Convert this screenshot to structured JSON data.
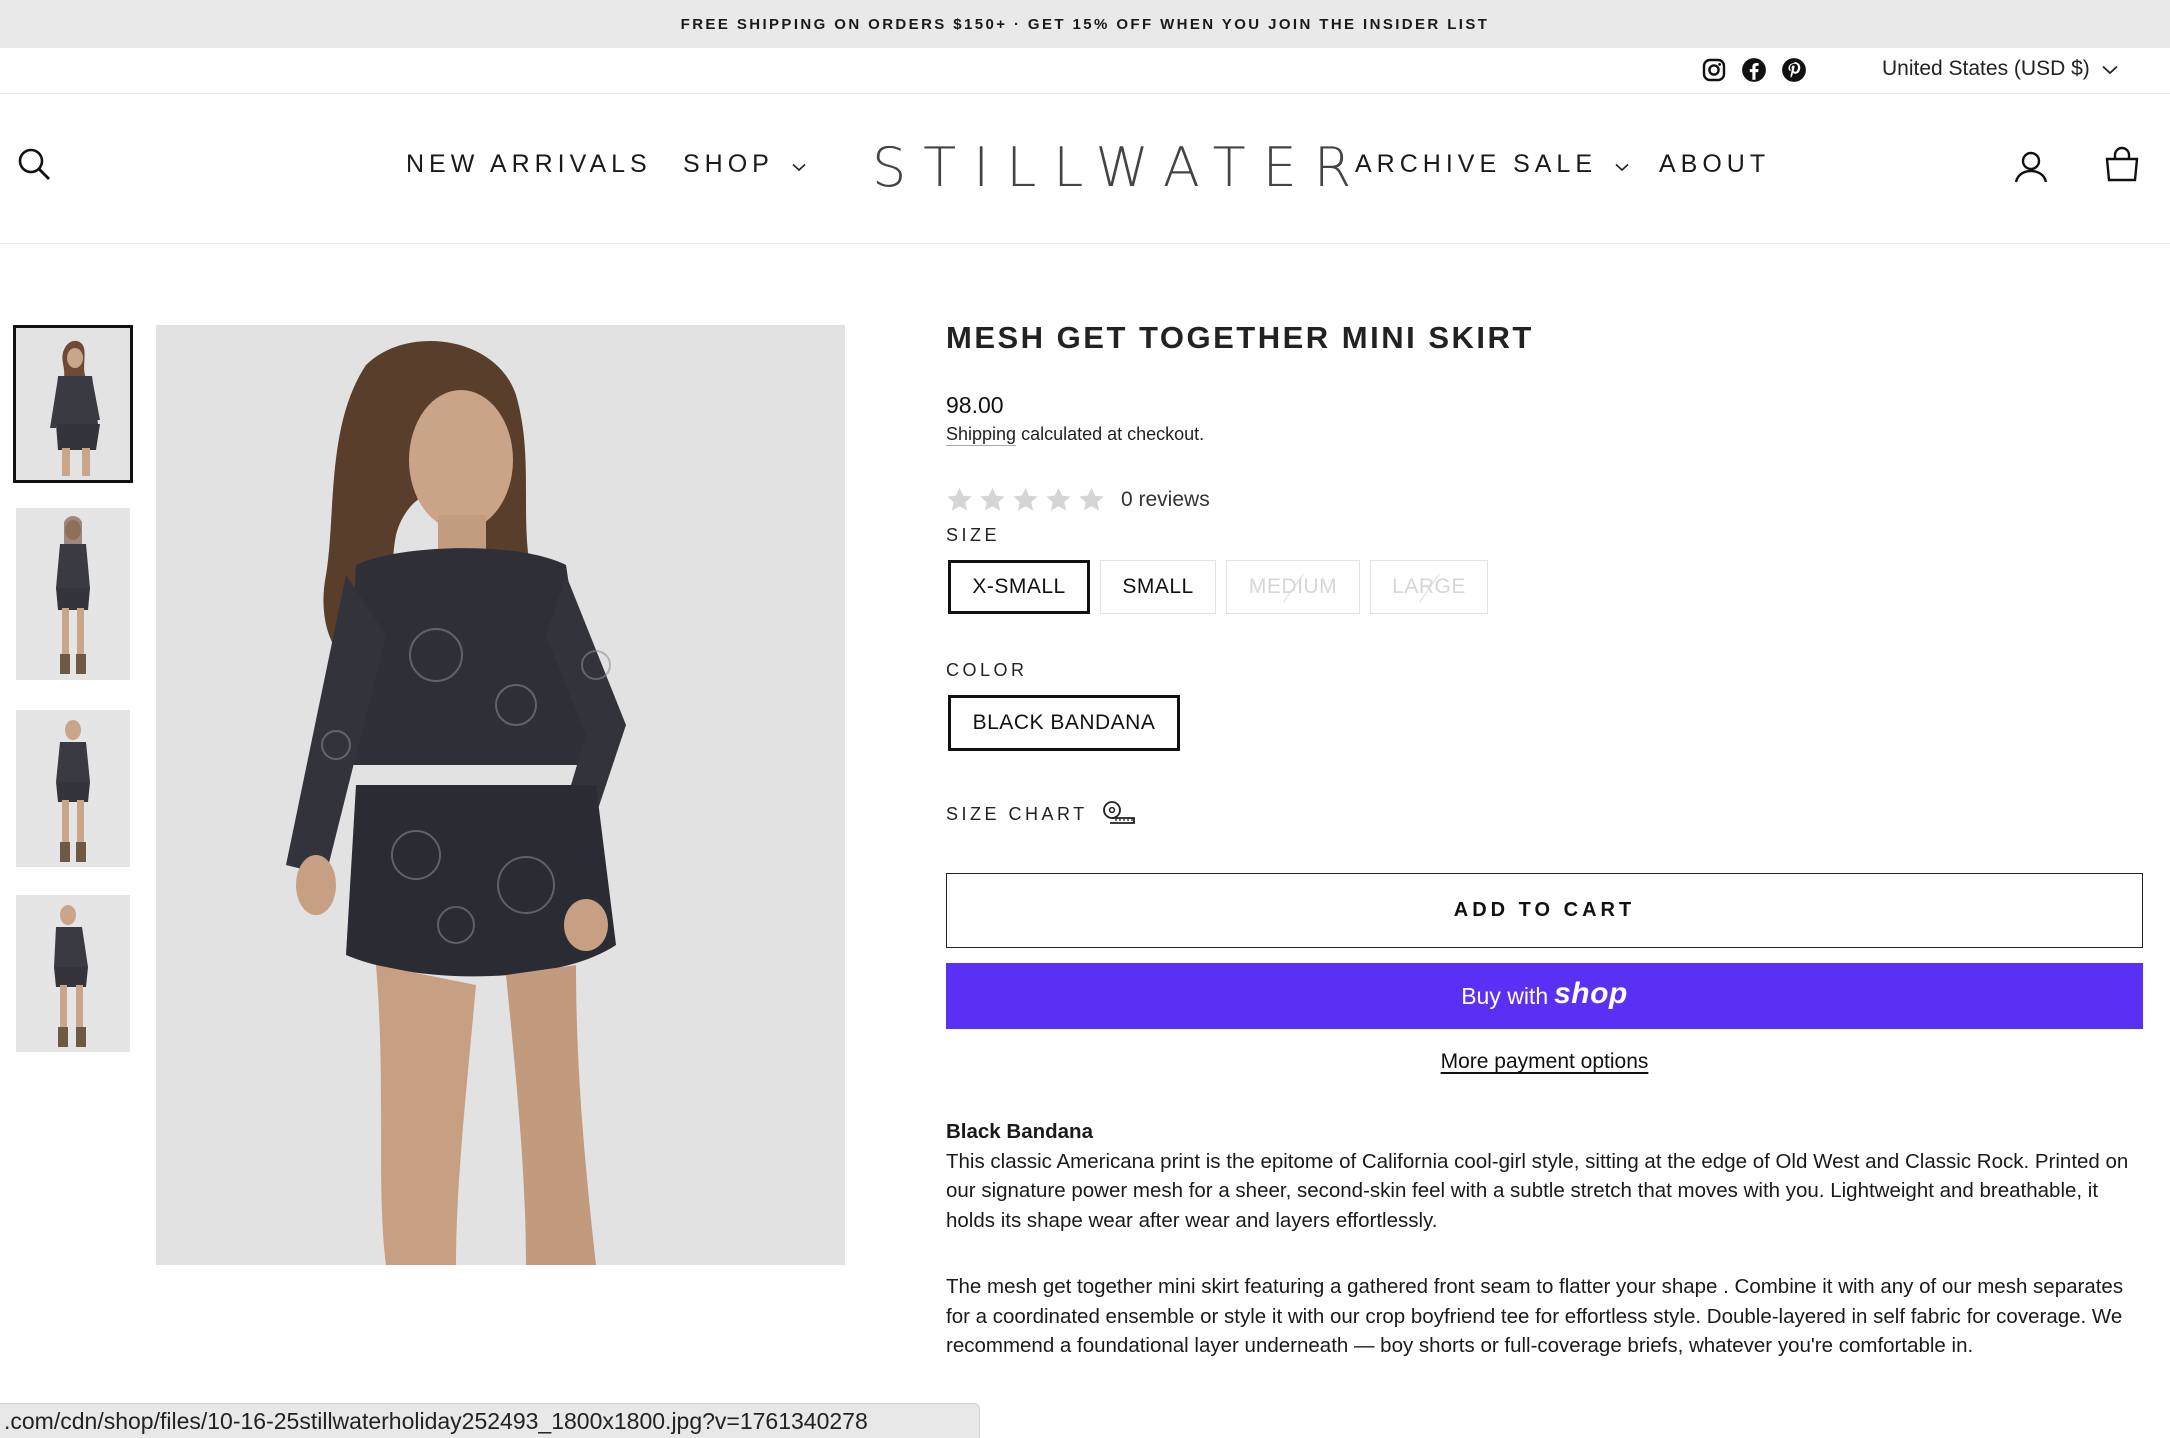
{
  "announcement": {
    "text": "FREE SHIPPING ON ORDERS $150+ · GET 15% OFF WHEN YOU JOIN THE INSIDER LIST"
  },
  "utility": {
    "social_icons": [
      "instagram-icon",
      "facebook-icon",
      "pinterest-icon"
    ],
    "currency": "United States (USD $)"
  },
  "nav": {
    "new_arrivals": "NEW ARRIVALS",
    "shop": "SHOP",
    "logo": "STILLWATER",
    "archive_sale": "ARCHIVE SALE",
    "about": "ABOUT",
    "icons": [
      "search-icon",
      "account-icon",
      "cart-icon"
    ]
  },
  "gallery": {
    "thumbnail_count": 4,
    "active_index": 0
  },
  "product": {
    "title": "MESH GET TOGETHER MINI SKIRT",
    "price": "98.00",
    "shipping_link": "Shipping",
    "shipping_rest": " calculated at checkout.",
    "rating_stars": 0,
    "reviews": "0 reviews",
    "size_label": "SIZE",
    "sizes": [
      {
        "label": "X-SMALL",
        "selected": true,
        "available": true
      },
      {
        "label": "SMALL",
        "selected": false,
        "available": true
      },
      {
        "label": "MEDIUM",
        "selected": false,
        "available": false
      },
      {
        "label": "LARGE",
        "selected": false,
        "available": false
      }
    ],
    "color_label": "COLOR",
    "color": "BLACK BANDANA",
    "size_chart": "SIZE CHART",
    "add_to_cart": "ADD TO CART",
    "buy_with": "Buy with",
    "buy_brand": "shop",
    "more_payment": "More payment options",
    "desc_title": "Black Bandana",
    "desc_p1": "This classic Americana print is the epitome of California cool-girl style, sitting at the edge of Old West and Classic Rock. Printed on our signature power mesh for a sheer, second-skin feel with a subtle stretch that moves with you. Lightweight and breathable, it holds its shape wear after wear and layers effortlessly.",
    "desc_p2": "The mesh get together mini skirt featuring a gathered front seam to flatter your shape . Combine it with any of our mesh separates for a coordinated ensemble or style it with our crop boyfriend tee for effortless style. Double-layered in self fabric for coverage. We recommend a foundational layer underneath — boy shorts or full-coverage briefs, whatever you're comfortable in."
  },
  "colors": {
    "shop_pay": "#5a31f4",
    "border_selected": "#111111",
    "announce_bg": "#e9e9e9"
  },
  "status_bar": {
    "url": ".com/cdn/shop/files/10-16-25stillwaterholiday252493_1800x1800.jpg?v=1761340278"
  }
}
